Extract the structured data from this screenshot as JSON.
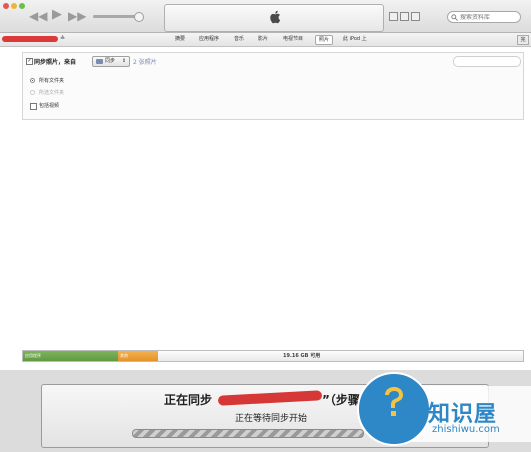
{
  "toolbar": {
    "search_placeholder": "搜索资料库",
    "eject_symbol": "≙"
  },
  "device": {
    "tabs": [
      {
        "label": "摘要",
        "active": false
      },
      {
        "label": "应用程序",
        "active": false
      },
      {
        "label": "音乐",
        "active": false
      },
      {
        "label": "影片",
        "active": false
      },
      {
        "label": "电视节目",
        "active": false
      },
      {
        "label": "照片",
        "active": true
      },
      {
        "label": "此 iPod 上",
        "active": false
      }
    ],
    "right_button": "完"
  },
  "photos": {
    "sync_label": "同步照片，来自",
    "sync_checked": true,
    "source_folder": "同步",
    "photo_count": "2 张照片",
    "options": [
      {
        "label": "所有文件夹",
        "type": "radio",
        "selected": true,
        "enabled": true
      },
      {
        "label": "所选文件夹",
        "type": "radio",
        "selected": false,
        "enabled": false
      },
      {
        "label": "包括视频",
        "type": "checkbox",
        "selected": false,
        "enabled": true
      }
    ]
  },
  "capacity": {
    "apps_label": "应用程序",
    "other_label": "其他",
    "free_text": "19.16 GB 可用"
  },
  "sync_status": {
    "line1_prefix": "正在同步",
    "line1_suffix": "”（步骤",
    "line2": "正在等待同步开始"
  },
  "watermark": {
    "title": "知识屋",
    "url": "zhishiwu.com"
  },
  "colors": {
    "apps": "#6aa748",
    "other": "#eea03c",
    "watermark": "#2e87c6"
  }
}
